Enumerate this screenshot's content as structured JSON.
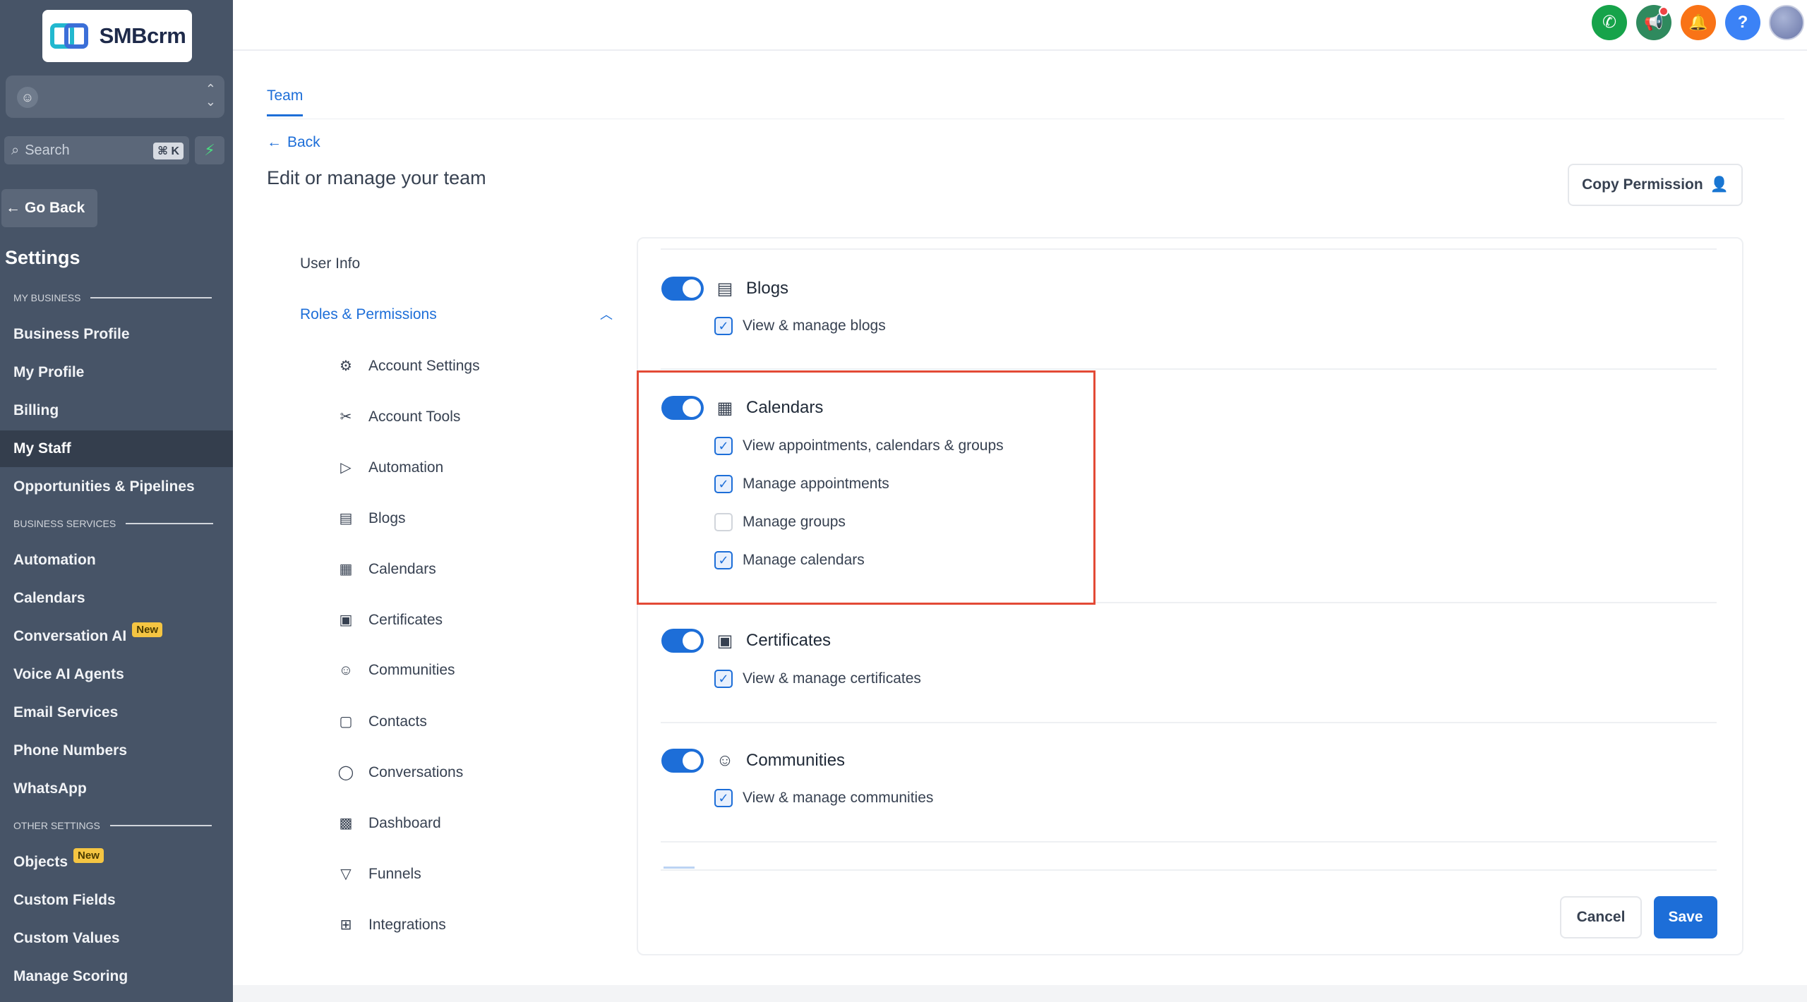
{
  "brand": {
    "name": "SMBcrm"
  },
  "sidebar": {
    "search_placeholder": "Search",
    "search_shortcut": "⌘ K",
    "go_back": "Go Back",
    "settings_title": "Settings",
    "sections": {
      "my_business": "MY BUSINESS",
      "business_services": "BUSINESS SERVICES",
      "other_settings": "OTHER SETTINGS"
    },
    "items": [
      {
        "label": "Business Profile"
      },
      {
        "label": "My Profile"
      },
      {
        "label": "Billing"
      },
      {
        "label": "My Staff",
        "active": true
      },
      {
        "label": "Opportunities & Pipelines"
      },
      {
        "label": "Automation"
      },
      {
        "label": "Calendars"
      },
      {
        "label": "Conversation AI",
        "badge": "New"
      },
      {
        "label": "Voice AI Agents"
      },
      {
        "label": "Email Services"
      },
      {
        "label": "Phone Numbers"
      },
      {
        "label": "WhatsApp"
      },
      {
        "label": "Objects",
        "badge": "New"
      },
      {
        "label": "Custom Fields"
      },
      {
        "label": "Custom Values"
      },
      {
        "label": "Manage Scoring"
      }
    ]
  },
  "topbar": {
    "icons": [
      {
        "name": "phone-icon",
        "color": "#16a34a",
        "glyph": "✆"
      },
      {
        "name": "megaphone-icon",
        "color": "#2f8a5e",
        "glyph": "📢"
      },
      {
        "name": "bell-icon",
        "color": "#f97316",
        "glyph": "🔔"
      },
      {
        "name": "help-icon",
        "color": "#3b82f6",
        "glyph": "?"
      }
    ]
  },
  "main": {
    "tab": "Team",
    "back": "Back",
    "page_title": "Edit or manage your team",
    "copy_permission": "Copy Permission",
    "subnav": {
      "user_info": "User Info",
      "roles": "Roles & Permissions",
      "items": [
        {
          "label": "Account Settings",
          "icon": "⚙"
        },
        {
          "label": "Account Tools",
          "icon": "✂"
        },
        {
          "label": "Automation",
          "icon": "▷"
        },
        {
          "label": "Blogs",
          "icon": "▤"
        },
        {
          "label": "Calendars",
          "icon": "▦"
        },
        {
          "label": "Certificates",
          "icon": "▣"
        },
        {
          "label": "Communities",
          "icon": "☺"
        },
        {
          "label": "Contacts",
          "icon": "▢"
        },
        {
          "label": "Conversations",
          "icon": "◯"
        },
        {
          "label": "Dashboard",
          "icon": "▩"
        },
        {
          "label": "Funnels",
          "icon": "▽"
        },
        {
          "label": "Integrations",
          "icon": "⊞"
        }
      ]
    },
    "permissions": {
      "blogs": {
        "title": "Blogs",
        "enabled": true,
        "options": [
          {
            "label": "View & manage blogs",
            "checked": true
          }
        ]
      },
      "calendars": {
        "title": "Calendars",
        "enabled": true,
        "options": [
          {
            "label": "View appointments, calendars & groups",
            "checked": true
          },
          {
            "label": "Manage appointments",
            "checked": true
          },
          {
            "label": "Manage groups",
            "checked": false
          },
          {
            "label": "Manage calendars",
            "checked": true
          }
        ]
      },
      "certificates": {
        "title": "Certificates",
        "enabled": true,
        "options": [
          {
            "label": "View & manage certificates",
            "checked": true
          }
        ]
      },
      "communities": {
        "title": "Communities",
        "enabled": true,
        "options": [
          {
            "label": "View & manage communities",
            "checked": true
          }
        ]
      }
    },
    "cancel": "Cancel",
    "save": "Save"
  }
}
